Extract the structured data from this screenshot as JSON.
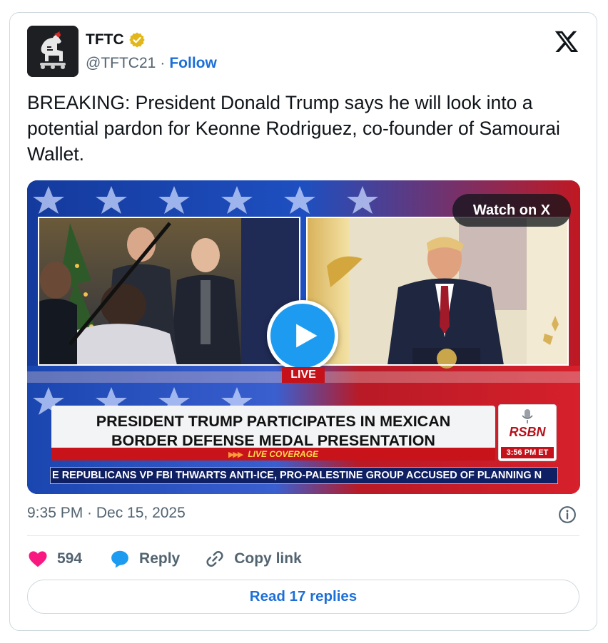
{
  "author": {
    "display_name": "TFTC",
    "handle": "@TFTC21",
    "separator": "·",
    "follow_label": "Follow"
  },
  "tweet": {
    "text": "BREAKING: President Donald Trump says he will look into a potential pardon for Keonne Rodriguez, co-founder of Samourai Wallet."
  },
  "media": {
    "watch_label": "Watch on X",
    "live_tag": "LIVE",
    "headline_line1": "PRESIDENT TRUMP PARTICIPATES IN MEXICAN",
    "headline_line2": "BORDER DEFENSE MEDAL PRESENTATION",
    "live_coverage": "LIVE COVERAGE",
    "network": "RSBN",
    "broadcast_time": "3:56 PM ET",
    "ticker": "E REPUBLICANS VP    FBI THWARTS ANTI-ICE, PRO-PALESTINE GROUP ACCUSED OF PLANNING N"
  },
  "meta": {
    "timestamp": "9:35 PM · Dec 15, 2025"
  },
  "actions": {
    "like_count": "594",
    "reply_label": "Reply",
    "copy_link_label": "Copy link",
    "read_replies_label": "Read 17 replies"
  },
  "colors": {
    "verified_gold": "#e2b719",
    "link_blue": "#1d6fd8",
    "like_pink": "#f91880",
    "reply_blue": "#1d9bf0",
    "play_blue": "#1d9bf0",
    "broadcast_red": "#c5121a",
    "broadcast_navy": "#0e1f63"
  },
  "icons": [
    "x-logo-icon",
    "verified-badge-icon",
    "play-icon",
    "info-icon",
    "heart-icon",
    "reply-bubble-icon",
    "link-icon"
  ]
}
